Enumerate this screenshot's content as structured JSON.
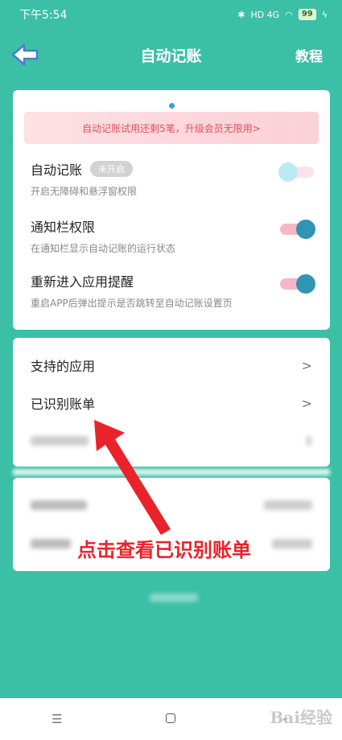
{
  "status_bar": {
    "time": "下午5:54",
    "signal": "HD 4G",
    "battery": "99"
  },
  "header": {
    "title": "自动记账",
    "tutorial": "教程"
  },
  "banner": {
    "text": "自动记账试用还剩5笔，升级会员无限用>"
  },
  "settings": [
    {
      "title": "自动记账",
      "badge": "未开启",
      "subtitle": "开启无障碍和悬浮窗权限",
      "toggle_on": false
    },
    {
      "title": "通知栏权限",
      "badge": "",
      "subtitle": "在通知栏显示自动记账的运行状态",
      "toggle_on": true
    },
    {
      "title": "重新进入应用提醒",
      "badge": "",
      "subtitle": "重启APP后弹出提示是否跳转至自动记账设置页",
      "toggle_on": true
    }
  ],
  "list": {
    "supported_apps": "支持的应用",
    "recognized_bills": "已识别账单",
    "chevron": ">"
  },
  "annotation": "点击查看已识别账单",
  "navbar": {
    "menu": "☰",
    "back": "‹"
  },
  "watermark": "Bai经验",
  "colors": {
    "background": "#3cbfa7",
    "accent_red": "#e8232c",
    "toggle_on": "#2f95b2"
  }
}
